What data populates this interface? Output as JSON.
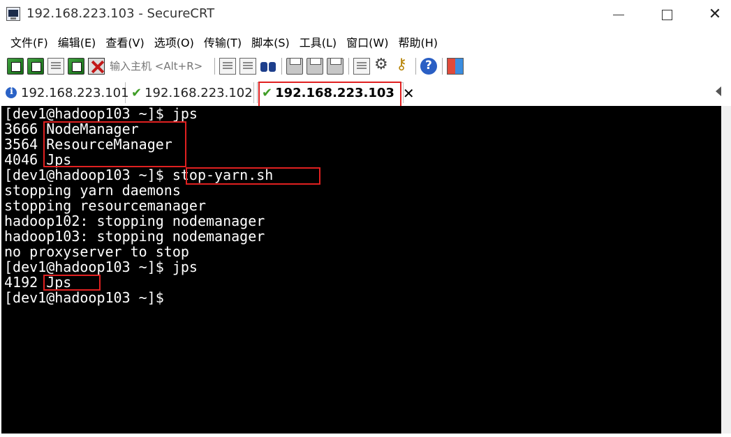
{
  "window": {
    "title": "192.168.223.103 - SecureCRT"
  },
  "menu": [
    {
      "label": "文件(F)"
    },
    {
      "label": "编辑(E)"
    },
    {
      "label": "查看(V)"
    },
    {
      "label": "选项(O)"
    },
    {
      "label": "传输(T)"
    },
    {
      "label": "脚本(S)"
    },
    {
      "label": "工具(L)"
    },
    {
      "label": "窗口(W)"
    },
    {
      "label": "帮助(H)"
    }
  ],
  "toolbar": {
    "host_placeholder": "输入主机 <Alt+R>"
  },
  "tabs": [
    {
      "label": "192.168.223.101",
      "status": "info"
    },
    {
      "label": "192.168.223.102",
      "status": "connected"
    },
    {
      "label": "192.168.223.103",
      "status": "connected",
      "active": true,
      "close": "✕"
    }
  ],
  "terminal": {
    "lines": [
      "[dev1@hadoop103 ~]$ jps",
      "3666 NodeManager",
      "3564 ResourceManager",
      "4046 Jps",
      "[dev1@hadoop103 ~]$ stop-yarn.sh",
      "stopping yarn daemons",
      "stopping resourcemanager",
      "hadoop102: stopping nodemanager",
      "hadoop103: stopping nodemanager",
      "no proxyserver to stop",
      "[dev1@hadoop103 ~]$ jps",
      "4192 Jps",
      "[dev1@hadoop103 ~]$"
    ],
    "background": "#000000",
    "foreground": "#ffffff"
  },
  "annotation_color": "#e02020"
}
